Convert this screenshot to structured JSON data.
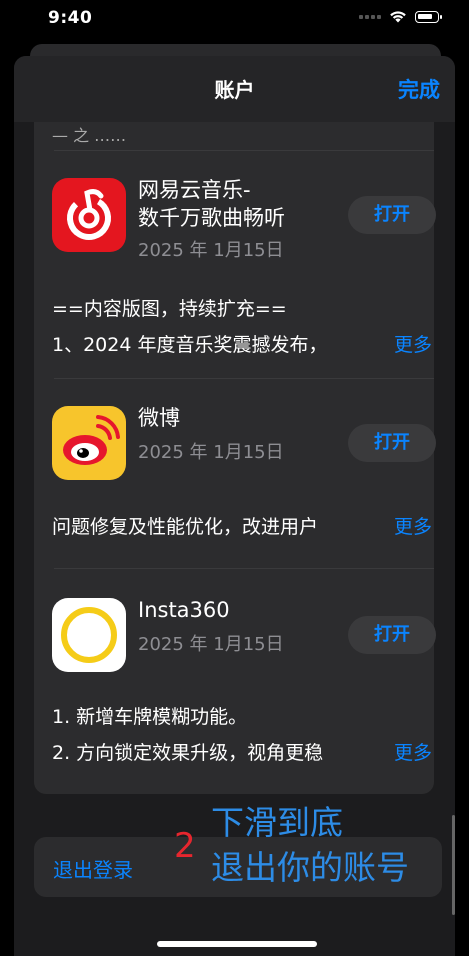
{
  "status": {
    "time": "9:40"
  },
  "nav": {
    "title": "账户",
    "done_label": "完成"
  },
  "cut_text": "— 之 ……",
  "apps": [
    {
      "name": "网易云音乐-\n数千万歌曲畅听",
      "date": "2025 年 1月15日",
      "open_label": "打开",
      "notes": [
        "==内容版图，持续扩充==",
        "1、2024 年度音乐奖震撼发布，"
      ],
      "more_label": "更多",
      "icon": "netease-music-icon"
    },
    {
      "name": "微博",
      "date": "2025 年 1月15日",
      "open_label": "打开",
      "notes": [
        "问题修复及性能优化，改进用户"
      ],
      "more_label": "更多",
      "icon": "weibo-icon"
    },
    {
      "name": "Insta360",
      "date": "2025 年 1月15日",
      "open_label": "打开",
      "notes": [
        "1. 新增车牌模糊功能。",
        "2. 方向锁定效果升级，视角更稳"
      ],
      "more_label": "更多",
      "icon": "insta360-icon"
    }
  ],
  "logout": {
    "label": "退出登录"
  },
  "annotation": {
    "number": "2",
    "text": "下滑到底\n退出你的账号"
  },
  "colors": {
    "accent": "#0a84ff",
    "annotation_number": "#e6262e",
    "annotation_text": "#2d8ce6",
    "netease_red": "#e4161f",
    "weibo_yellow": "#f7c52c"
  }
}
